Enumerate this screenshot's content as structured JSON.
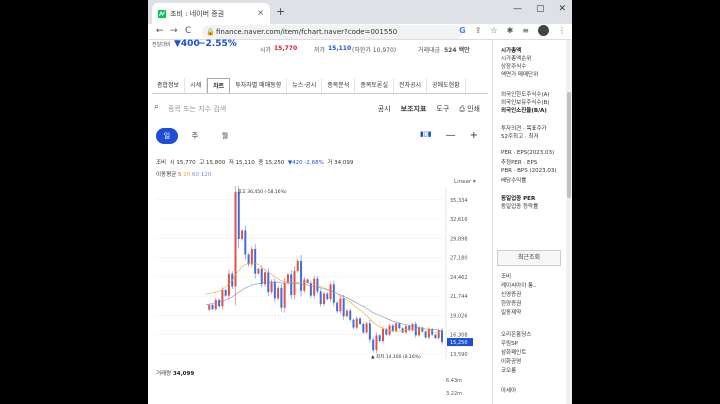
{
  "browser": {
    "tab_title": "조비 : 네이버 증권",
    "url": "finance.naver.com/item/fchart.naver?code=001550",
    "new_tab": "+",
    "close": "×",
    "back": "←",
    "forward": "→",
    "reload": "C",
    "google": "G",
    "share": "⇪",
    "star": "☆",
    "ext": "✱",
    "reading": "≡",
    "menu": "⋮",
    "minimize": "—",
    "maximize": "▢",
    "winclose": "✕",
    "lock": "🔒"
  },
  "summary": {
    "label_prev": "전일대비",
    "change_value": "▼400",
    "change_pct": "−2.55%",
    "open_label": "시가",
    "open_value": "15,770",
    "low_label": "저가",
    "low_value": "15,110",
    "low_limit": "(하한가 10,970)",
    "volume_label": "거래대금",
    "volume_value": "524 백만"
  },
  "menu": [
    "종합정보",
    "시세",
    "차트",
    "투자자별 매매동향",
    "뉴스·공시",
    "종목분석",
    "종목토론실",
    "전자공시",
    "공매도현황"
  ],
  "search": {
    "placeholder": "종목 또는 지수 검색",
    "notice": "공시",
    "indicator": "보조지표",
    "tool": "도구",
    "print": "⎙ 인쇄"
  },
  "periods": [
    "일",
    "주",
    "월"
  ],
  "chart_tools": {
    "candle": "▮▯▮",
    "minus": "—",
    "plus": "+"
  },
  "quote_line": {
    "name": "조비",
    "open": "시 15,770",
    "high": "고 15,800",
    "low": "저 15,110",
    "close": "종 15,250",
    "change": "▼420 -2.68%",
    "volume": "거 34,099"
  },
  "moving_avg": {
    "label": "이동평균",
    "ma5": "5",
    "ma20": "20",
    "ma60": "60",
    "ma120": "120"
  },
  "scale_mode": "Linear ▾",
  "chart_data": {
    "type": "line",
    "yticks": [
      35334,
      32616,
      29898,
      27180,
      24462,
      21744,
      19026,
      16308,
      13590
    ],
    "ylim": [
      13000,
      37000
    ],
    "current_label": "15,250",
    "high_annotation": "최고 36,450 (-58.16%)",
    "low_annotation": "▲ 최저 14,100 (8.16%)",
    "close": [
      19800,
      20500,
      19900,
      21200,
      20300,
      22600,
      21800,
      24900,
      23100,
      36450,
      29800,
      31000,
      27600,
      26200,
      28400,
      24900,
      25600,
      23400,
      25100,
      22300,
      23800,
      21400,
      22900,
      20100,
      23600,
      24800,
      21900,
      25300,
      26700,
      22500,
      24100,
      23600,
      21800,
      24200,
      22400,
      20600,
      22100,
      21300,
      23400,
      20800,
      19600,
      21400,
      18900,
      19700,
      18400,
      17300,
      18600,
      17800,
      16600,
      17900,
      15600,
      14100,
      16200,
      15400,
      17100,
      16300,
      17600,
      16800,
      17900,
      17200,
      16600,
      17500,
      16900,
      17800,
      16200,
      17300,
      16700,
      15900,
      17100,
      16300,
      15800,
      16900,
      15250
    ],
    "ma20": [
      22000,
      22100,
      22200,
      22300,
      22400,
      22700,
      23000,
      23500,
      23900,
      24800,
      25300,
      25900,
      26200,
      26400,
      26500,
      26400,
      26200,
      25800,
      25500,
      25100,
      24800,
      24500,
      24200,
      23900,
      23800,
      23700,
      23600,
      23600,
      23700,
      23700,
      23700,
      23600,
      23500,
      23400,
      23300,
      23100,
      22900,
      22700,
      22500,
      22300,
      22100,
      21800,
      21500,
      21200,
      20900,
      20500,
      20100,
      19800,
      19400,
      19000,
      18500,
      18000,
      17700,
      17400,
      17200,
      17000,
      16900,
      16800,
      16800,
      16800,
      16900,
      17000,
      17000,
      17000,
      16900,
      16900,
      16800,
      16800,
      16700,
      16700,
      16600,
      16600,
      16500
    ],
    "ma60": [
      20500,
      20600,
      20700,
      20800,
      20900,
      21000,
      21200,
      21400,
      21600,
      22000,
      22300,
      22600,
      22900,
      23100,
      23300,
      23400,
      23500,
      23600,
      23700,
      23700,
      23700,
      23700,
      23700,
      23600,
      23600,
      23600,
      23500,
      23500,
      23500,
      23400,
      23400,
      23300,
      23200,
      23100,
      23000,
      22900,
      22800,
      22600,
      22500,
      22300,
      22100,
      21900,
      21700,
      21500,
      21300,
      21000,
      20800,
      20500,
      20300,
      20000,
      19700,
      19400,
      19200,
      19000,
      18800,
      18600,
      18400,
      18200,
      18100,
      17900,
      17800,
      17700,
      17600,
      17500,
      17400,
      17300,
      17200,
      17100,
      17100,
      17000,
      17000,
      16900,
      16900
    ]
  },
  "volume_line": {
    "label": "거래량",
    "value": "34,099",
    "tick1": "6.43m",
    "tick2": "3.22m"
  },
  "sidebar": {
    "lines": [
      "시가총액",
      "시가총액순위",
      "상장주식수",
      "액면가  매매단위",
      "외국인한도주식수(A)",
      "외국인보유주식수(B)",
      "외국인소진율(B/A)",
      "투자의견 · 목표주가",
      "52주최고 · 최저",
      "PER · EPS(2023.03)",
      "추정PER · EPS",
      "PBR · BPS (2023.03)",
      "배당수익률",
      "동일업종 PER",
      "동일업종 등락률"
    ],
    "recent_title": "최근조회",
    "recent": [
      "조비",
      "케이씨아이 통..",
      "신영증권",
      "한양증권",
      "일동제약",
      "오리온홀딩스",
      "우림SP",
      "삼화페인트",
      "이화공영",
      "코오롱",
      "아세아"
    ]
  }
}
